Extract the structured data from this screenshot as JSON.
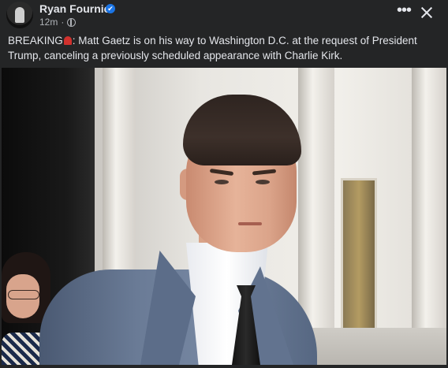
{
  "post": {
    "author": "Ryan Fournier",
    "verified_glyph": "✔",
    "time": "12m",
    "separator": "·",
    "text_before_icon": "BREAKING",
    "text_after_icon": ": Matt Gaetz is on his way to Washington D.C. at the request of President Trump, canceling a previously scheduled appearance with Charlie Kirk.",
    "more_glyph": "•••",
    "icons": {
      "avatar": "avatar-icon",
      "verified": "verified-badge-icon",
      "audience": "globe-icon",
      "breaking": "siren-icon",
      "more": "more-options-icon",
      "close": "close-icon"
    }
  },
  "colors": {
    "background": "#242526",
    "text": "#e4e6eb",
    "secondary_text": "#b0b3b8",
    "verified_blue": "#1b74e4",
    "siren_red": "#d0312d"
  }
}
